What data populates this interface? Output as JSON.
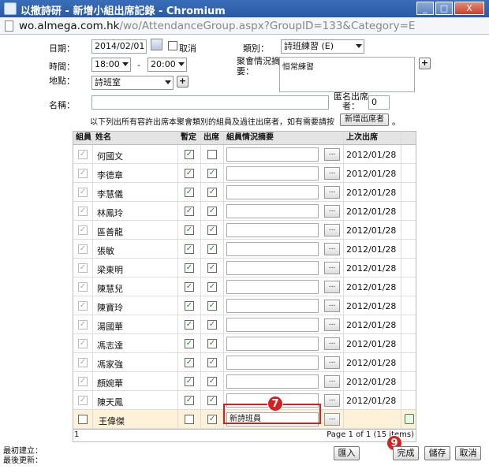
{
  "window": {
    "title": "以撒詩研 - 新增小組出席記錄 - Chromium",
    "min": "_",
    "max": "□",
    "close": "X"
  },
  "address": {
    "host": "wo.almega.com.hk",
    "path": "/wo/AttendanceGroup.aspx?GroupID=133&Category=E"
  },
  "form": {
    "date_label": "日期：",
    "date_value": "2014/02/01",
    "cancel_label": "取消",
    "category_label": "類別：",
    "category_value": "詩班練習 (E)",
    "time_label": "時間：",
    "time_start": "18:00",
    "time_sep": "-",
    "time_end": "20:00",
    "summary_label": "聚會情況摘要：",
    "summary_value": "恒常練習",
    "place_label": "地點：",
    "place_value": "詩班室",
    "name_label": "名稱：",
    "name_value": "",
    "anon_label": "匿名出席者：",
    "anon_value": "0",
    "hint": "以下列出所有容許出席本聚會類別的組員及過往出席者，如有需要請按",
    "add_attendee_button": "新增出席者",
    "hint_end": "。",
    "plus": "+"
  },
  "table": {
    "headers": [
      "組員",
      "姓名",
      "暫定",
      "出席",
      "組員情況摘要",
      "上次出席"
    ],
    "rows": [
      {
        "name": "何國文",
        "tentative": true,
        "present": false,
        "date": "2012/01/28"
      },
      {
        "name": "李德章",
        "tentative": true,
        "present": true,
        "date": "2012/01/28"
      },
      {
        "name": "李慧儀",
        "tentative": true,
        "present": true,
        "date": "2012/01/28"
      },
      {
        "name": "林鳳玲",
        "tentative": true,
        "present": true,
        "date": "2012/01/28"
      },
      {
        "name": "區善龍",
        "tentative": true,
        "present": true,
        "date": "2012/01/28"
      },
      {
        "name": "張敏",
        "tentative": true,
        "present": true,
        "date": "2012/01/28"
      },
      {
        "name": "梁東明",
        "tentative": true,
        "present": true,
        "date": "2012/01/28"
      },
      {
        "name": "陳慧兒",
        "tentative": true,
        "present": true,
        "date": "2012/01/28"
      },
      {
        "name": "陳寶玲",
        "tentative": true,
        "present": true,
        "date": "2012/01/28"
      },
      {
        "name": "湯國華",
        "tentative": true,
        "present": true,
        "date": "2012/01/28"
      },
      {
        "name": "馮志達",
        "tentative": true,
        "present": true,
        "date": "2012/01/28"
      },
      {
        "name": "馮家強",
        "tentative": true,
        "present": true,
        "date": "2012/01/28"
      },
      {
        "name": "顏婉華",
        "tentative": true,
        "present": true,
        "date": "2012/01/28"
      },
      {
        "name": "陳天鳳",
        "tentative": true,
        "present": true,
        "date": "2012/01/28"
      }
    ],
    "new_row": {
      "name": "王偉傑",
      "tentative": false,
      "present": true,
      "summary": "新詩班員"
    },
    "dots": "...",
    "footer_left": "1",
    "footer_right": "Page 1 of 1 (15 items)"
  },
  "bottom": {
    "created_label": "最初建立：",
    "updated_label": "最後更新：",
    "import_button": "匯入",
    "done_button": "完成",
    "save_button": "儲存",
    "cancel_button": "取消"
  },
  "markers": {
    "m7": "7",
    "m9": "9"
  },
  "icons": [
    "calendar-icon",
    "delete-icon",
    "document-icon"
  ],
  "colors": {
    "titlebar": "#2f62ad",
    "marker": "#d42020",
    "new_row": "#fdf2d8",
    "check": "#2a8a2a"
  }
}
